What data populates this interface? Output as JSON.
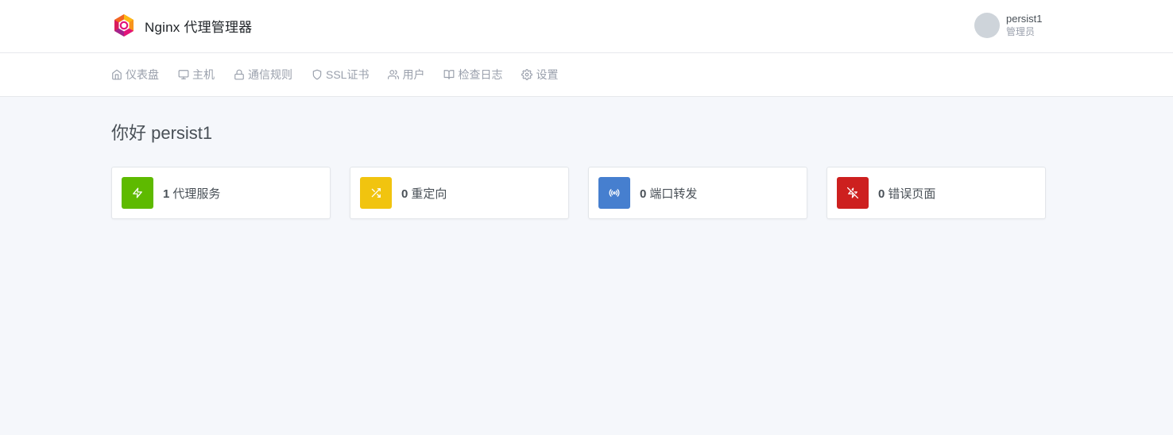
{
  "app": {
    "title": "Nginx 代理管理器"
  },
  "user": {
    "name": "persist1",
    "role": "管理员"
  },
  "nav": {
    "items": [
      {
        "label": "仪表盘",
        "icon": "home-icon"
      },
      {
        "label": "主机",
        "icon": "monitor-icon"
      },
      {
        "label": "通信规则",
        "icon": "lock-icon"
      },
      {
        "label": "SSL证书",
        "icon": "shield-icon"
      },
      {
        "label": "用户",
        "icon": "users-icon"
      },
      {
        "label": "检查日志",
        "icon": "book-open-icon"
      },
      {
        "label": "设置",
        "icon": "gear-icon"
      }
    ]
  },
  "main": {
    "greeting": "你好 persist1",
    "cards": [
      {
        "count": "1",
        "label": "代理服务",
        "color": "#5eba00",
        "icon": "zap-icon"
      },
      {
        "count": "0",
        "label": "重定向",
        "color": "#f1c40f",
        "icon": "shuffle-icon"
      },
      {
        "count": "0",
        "label": "端口转发",
        "color": "#467fcf",
        "icon": "radio-icon"
      },
      {
        "count": "0",
        "label": "错误页面",
        "color": "#cd201f",
        "icon": "zap-off-icon"
      }
    ]
  },
  "colors": {
    "background": "#f5f7fb",
    "header": "#ffffff",
    "nav_text": "#9aa0ac"
  }
}
